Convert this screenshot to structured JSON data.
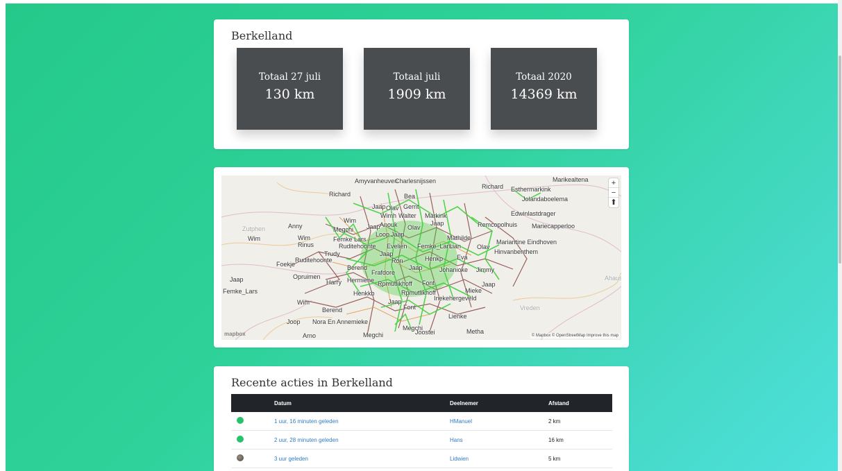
{
  "stats_card": {
    "title": "Berkelland",
    "stats": [
      {
        "label": "Totaal 27 juli",
        "value": "130 km"
      },
      {
        "label": "Totaal juli",
        "value": "1909 km"
      },
      {
        "label": "Totaal 2020",
        "value": "14369 km"
      }
    ]
  },
  "map": {
    "labels": [
      "Amyvanheuven",
      "Charlesnijssen",
      "Richard",
      "Richard",
      "Marikealtena",
      "Esthermarkink",
      "Jolandaboelema",
      "Edwinlastdrager",
      "Jaap",
      "Olav",
      "Gerrit",
      "Bea",
      "Wim",
      "Wimh",
      "Walter",
      "Markink",
      "Anny",
      "Megchi",
      "Jaap",
      "Anouk",
      "Olav",
      "Jaap",
      "Remcopolhuis",
      "Mariecapperloo",
      "Wim",
      "Wim",
      "Femke Lars",
      "Loop",
      "Jaap",
      "Mathilde",
      "Mariantine Eindhoven",
      "Rinus",
      "Ruditehoonte",
      "Evelien",
      "Femke_Lars",
      "Lian",
      "Olav",
      "Hinvanbenthem",
      "Trudy",
      "Jaap",
      "Eva",
      "Foekje",
      "Ruditehoonte",
      "Ron",
      "Henkp",
      "Johanioke",
      "Jimmy",
      "Berend",
      "Frafdore",
      "Jaap",
      "Opruimen",
      "Hermiene",
      "Harry",
      "Rpmutlikhoff",
      "Font",
      "Jaap",
      "Jaap",
      "Henkkb",
      "Rpmutlikhoff",
      "Mieke",
      "Femke_Lars",
      "Jaap",
      "Inekehergeveld",
      "Wim",
      "Berend",
      "Font",
      "Lienke",
      "Joop",
      "Nora En Annemieke",
      "Megchi",
      "Joostei",
      "Metha",
      "Arno",
      "Megchi",
      "Ahaus",
      "Vreden",
      "Zutphen"
    ],
    "zoom_in": "+",
    "zoom_out": "−",
    "compass": "⬆",
    "attribution": "© Mapbox © OpenStreetMap Improve this map",
    "logo": "mapbox"
  },
  "recent_card": {
    "title": "Recente acties in Berkelland",
    "columns": {
      "datum": "Datum",
      "deelnemer": "Deelnemer",
      "afstand": "Afstand"
    },
    "rows": [
      {
        "avatar": "green",
        "datum": "1 uur, 16 minuten geleden",
        "deelnemer": "HManuel",
        "afstand": "2 km"
      },
      {
        "avatar": "green",
        "datum": "2 uur, 28 minuten geleden",
        "deelnemer": "Hans",
        "afstand": "16 km"
      },
      {
        "avatar": "photo",
        "datum": "3 uur geleden",
        "deelnemer": "Lidwien",
        "afstand": "5 km"
      }
    ]
  },
  "colors": {
    "stat_bg": "#4a4d50",
    "table_header_bg": "#212529",
    "link": "#2f7bc4",
    "route_green": "#3fcf3a",
    "road_brown": "#7a2e2e",
    "road_orange": "#e0913a"
  }
}
